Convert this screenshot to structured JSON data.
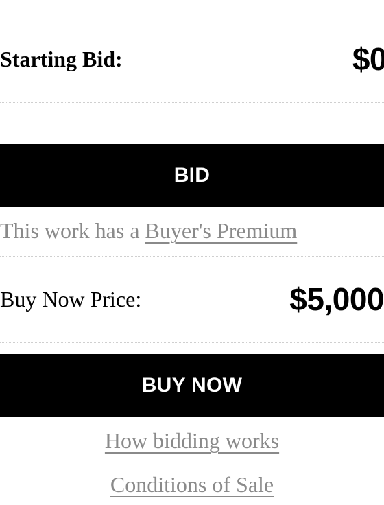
{
  "starting_bid": {
    "label": "Starting Bid:",
    "value": "$0"
  },
  "bid_button": {
    "label": "BID"
  },
  "premium_note": {
    "text": "This work has a ",
    "link": "Buyer's Premium"
  },
  "buy_now": {
    "label": "Buy Now Price:",
    "value": "$5,000"
  },
  "buy_now_button": {
    "label": "BUY NOW"
  },
  "links": {
    "how_bidding_works": "How bidding works",
    "conditions_of_sale": "Conditions of Sale"
  }
}
